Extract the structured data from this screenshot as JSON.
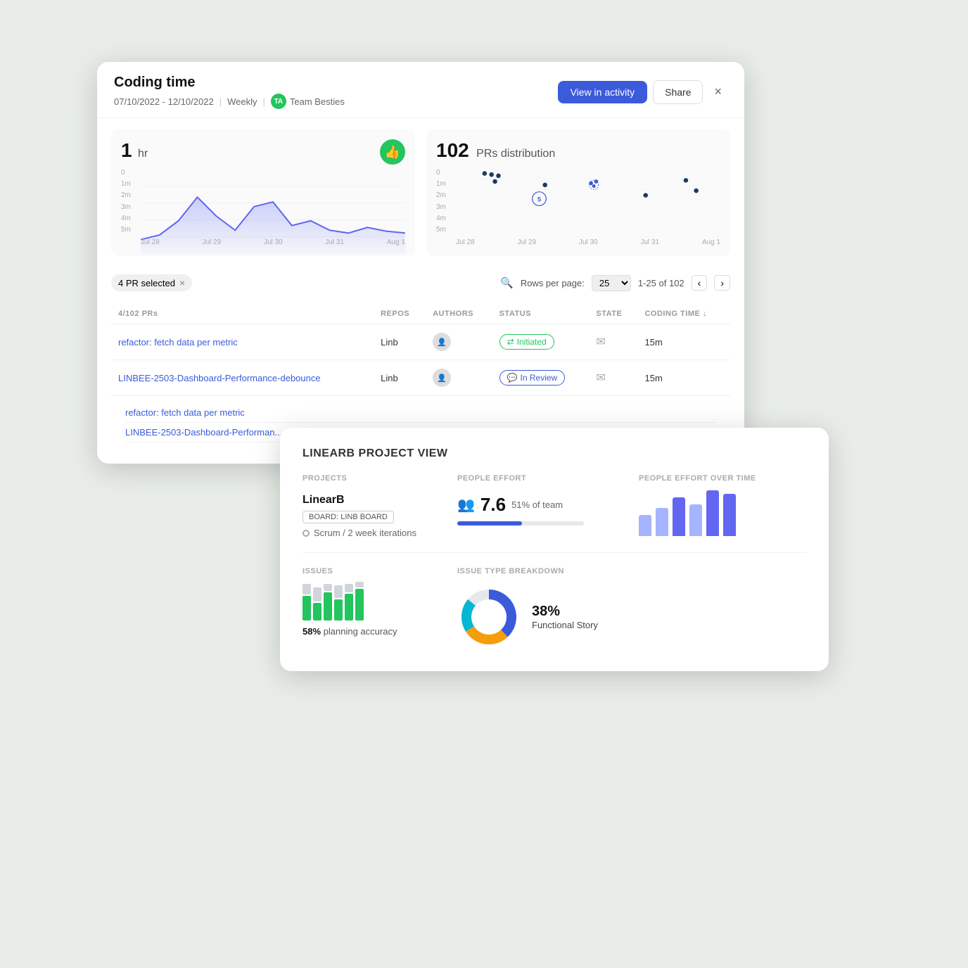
{
  "mainCard": {
    "title": "Coding time",
    "dateRange": "07/10/2022 - 12/10/2022",
    "interval": "Weekly",
    "team": "Team Besties",
    "teamInitials": "TA",
    "actions": {
      "viewInActivity": "View in activity",
      "share": "Share",
      "close": "×"
    }
  },
  "codingTimeChart": {
    "stat": "1",
    "unit": "hr",
    "icon": "👍",
    "yLabels": [
      "0",
      "1m",
      "2m",
      "3m",
      "4m",
      "5m"
    ],
    "xLabels": [
      "Jul 28",
      "Jul 29",
      "Jul 30",
      "Jul 31",
      "Aug 1"
    ]
  },
  "prsDistributionChart": {
    "stat": "102",
    "label": "PRs distribution",
    "yLabels": [
      "0",
      "1m",
      "2m",
      "3m",
      "4m",
      "5m"
    ],
    "xLabels": [
      "Jul 28",
      "Jul 29",
      "Jul 30",
      "Jul 31",
      "Aug 1"
    ]
  },
  "tableToolbar": {
    "prSelected": "4 PR selected",
    "rowsPerPage": "Rows per page:",
    "rowsValue": "25",
    "pagination": "1-25 of 102",
    "prCount": "4/102 PRs"
  },
  "tableColumns": {
    "repos": "REPOS",
    "authors": "AUTHORS",
    "status": "STATUS",
    "state": "STATE",
    "codingTime": "CODING TIME ↓"
  },
  "tableRows": [
    {
      "id": "row-1",
      "pr": "refactor: fetch data per metric",
      "repo": "Linb",
      "status": "Initiated",
      "statusType": "initiated",
      "state": "✉",
      "codingTime": "15m"
    },
    {
      "id": "row-2",
      "pr": "LINBEE-2503-Dashboard-Performance-debounce",
      "repo": "Linb",
      "status": "In Review",
      "statusType": "inreview",
      "state": "✉",
      "codingTime": "15m"
    }
  ],
  "subList": [
    "refactor: fetch data per metric",
    "LINBEE-2503-Dashboard-Performan..."
  ],
  "projectCard": {
    "title": "LINEARB PROJECT VIEW",
    "columns": {
      "projects": "PROJECTS",
      "peopleEffort": "PEOPLE EFFORT",
      "peopleEffortOverTime": "PEOPLE EFFORT OVER TIME"
    },
    "project": {
      "name": "LinearB",
      "board": "BOARD: LINB BOARD",
      "methodology": "Scrum / 2 week iterations"
    },
    "effort": {
      "value": "7.6",
      "percent": "51% of team",
      "barWidth": 51
    },
    "effortBars": [
      30,
      40,
      55,
      45,
      65,
      70
    ],
    "issues": {
      "header": "ISSUES",
      "planningAccuracy": "58%",
      "planningLabel": "planning accuracy",
      "breakdown": {
        "header": "ISSUE TYPE BREAKDOWN",
        "percent": "38%",
        "label": "Functional Story"
      }
    },
    "planningBars": [
      {
        "green": 35,
        "gray": 15
      },
      {
        "green": 25,
        "gray": 20
      },
      {
        "green": 40,
        "gray": 10
      },
      {
        "green": 30,
        "gray": 18
      },
      {
        "green": 38,
        "gray": 12
      },
      {
        "green": 45,
        "gray": 8
      }
    ],
    "donutSegments": [
      {
        "color": "#3b5bdb",
        "pct": 38
      },
      {
        "color": "#f59e0b",
        "pct": 28
      },
      {
        "color": "#06b6d4",
        "pct": 20
      },
      {
        "color": "#e5e7eb",
        "pct": 14
      }
    ]
  }
}
